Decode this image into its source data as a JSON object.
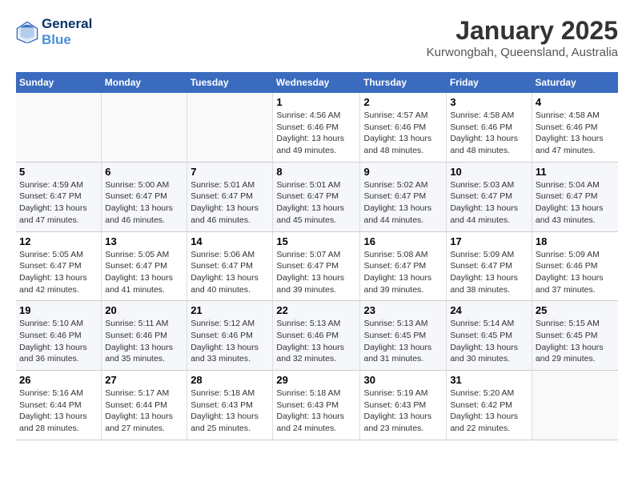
{
  "header": {
    "logo_line1": "General",
    "logo_line2": "Blue",
    "month_year": "January 2025",
    "location": "Kurwongbah, Queensland, Australia"
  },
  "days_of_week": [
    "Sunday",
    "Monday",
    "Tuesday",
    "Wednesday",
    "Thursday",
    "Friday",
    "Saturday"
  ],
  "weeks": [
    [
      {
        "day": "",
        "info": ""
      },
      {
        "day": "",
        "info": ""
      },
      {
        "day": "",
        "info": ""
      },
      {
        "day": "1",
        "info": "Sunrise: 4:56 AM\nSunset: 6:46 PM\nDaylight: 13 hours\nand 49 minutes."
      },
      {
        "day": "2",
        "info": "Sunrise: 4:57 AM\nSunset: 6:46 PM\nDaylight: 13 hours\nand 48 minutes."
      },
      {
        "day": "3",
        "info": "Sunrise: 4:58 AM\nSunset: 6:46 PM\nDaylight: 13 hours\nand 48 minutes."
      },
      {
        "day": "4",
        "info": "Sunrise: 4:58 AM\nSunset: 6:46 PM\nDaylight: 13 hours\nand 47 minutes."
      }
    ],
    [
      {
        "day": "5",
        "info": "Sunrise: 4:59 AM\nSunset: 6:47 PM\nDaylight: 13 hours\nand 47 minutes."
      },
      {
        "day": "6",
        "info": "Sunrise: 5:00 AM\nSunset: 6:47 PM\nDaylight: 13 hours\nand 46 minutes."
      },
      {
        "day": "7",
        "info": "Sunrise: 5:01 AM\nSunset: 6:47 PM\nDaylight: 13 hours\nand 46 minutes."
      },
      {
        "day": "8",
        "info": "Sunrise: 5:01 AM\nSunset: 6:47 PM\nDaylight: 13 hours\nand 45 minutes."
      },
      {
        "day": "9",
        "info": "Sunrise: 5:02 AM\nSunset: 6:47 PM\nDaylight: 13 hours\nand 44 minutes."
      },
      {
        "day": "10",
        "info": "Sunrise: 5:03 AM\nSunset: 6:47 PM\nDaylight: 13 hours\nand 44 minutes."
      },
      {
        "day": "11",
        "info": "Sunrise: 5:04 AM\nSunset: 6:47 PM\nDaylight: 13 hours\nand 43 minutes."
      }
    ],
    [
      {
        "day": "12",
        "info": "Sunrise: 5:05 AM\nSunset: 6:47 PM\nDaylight: 13 hours\nand 42 minutes."
      },
      {
        "day": "13",
        "info": "Sunrise: 5:05 AM\nSunset: 6:47 PM\nDaylight: 13 hours\nand 41 minutes."
      },
      {
        "day": "14",
        "info": "Sunrise: 5:06 AM\nSunset: 6:47 PM\nDaylight: 13 hours\nand 40 minutes."
      },
      {
        "day": "15",
        "info": "Sunrise: 5:07 AM\nSunset: 6:47 PM\nDaylight: 13 hours\nand 39 minutes."
      },
      {
        "day": "16",
        "info": "Sunrise: 5:08 AM\nSunset: 6:47 PM\nDaylight: 13 hours\nand 39 minutes."
      },
      {
        "day": "17",
        "info": "Sunrise: 5:09 AM\nSunset: 6:47 PM\nDaylight: 13 hours\nand 38 minutes."
      },
      {
        "day": "18",
        "info": "Sunrise: 5:09 AM\nSunset: 6:46 PM\nDaylight: 13 hours\nand 37 minutes."
      }
    ],
    [
      {
        "day": "19",
        "info": "Sunrise: 5:10 AM\nSunset: 6:46 PM\nDaylight: 13 hours\nand 36 minutes."
      },
      {
        "day": "20",
        "info": "Sunrise: 5:11 AM\nSunset: 6:46 PM\nDaylight: 13 hours\nand 35 minutes."
      },
      {
        "day": "21",
        "info": "Sunrise: 5:12 AM\nSunset: 6:46 PM\nDaylight: 13 hours\nand 33 minutes."
      },
      {
        "day": "22",
        "info": "Sunrise: 5:13 AM\nSunset: 6:46 PM\nDaylight: 13 hours\nand 32 minutes."
      },
      {
        "day": "23",
        "info": "Sunrise: 5:13 AM\nSunset: 6:45 PM\nDaylight: 13 hours\nand 31 minutes."
      },
      {
        "day": "24",
        "info": "Sunrise: 5:14 AM\nSunset: 6:45 PM\nDaylight: 13 hours\nand 30 minutes."
      },
      {
        "day": "25",
        "info": "Sunrise: 5:15 AM\nSunset: 6:45 PM\nDaylight: 13 hours\nand 29 minutes."
      }
    ],
    [
      {
        "day": "26",
        "info": "Sunrise: 5:16 AM\nSunset: 6:44 PM\nDaylight: 13 hours\nand 28 minutes."
      },
      {
        "day": "27",
        "info": "Sunrise: 5:17 AM\nSunset: 6:44 PM\nDaylight: 13 hours\nand 27 minutes."
      },
      {
        "day": "28",
        "info": "Sunrise: 5:18 AM\nSunset: 6:43 PM\nDaylight: 13 hours\nand 25 minutes."
      },
      {
        "day": "29",
        "info": "Sunrise: 5:18 AM\nSunset: 6:43 PM\nDaylight: 13 hours\nand 24 minutes."
      },
      {
        "day": "30",
        "info": "Sunrise: 5:19 AM\nSunset: 6:43 PM\nDaylight: 13 hours\nand 23 minutes."
      },
      {
        "day": "31",
        "info": "Sunrise: 5:20 AM\nSunset: 6:42 PM\nDaylight: 13 hours\nand 22 minutes."
      },
      {
        "day": "",
        "info": ""
      }
    ]
  ]
}
